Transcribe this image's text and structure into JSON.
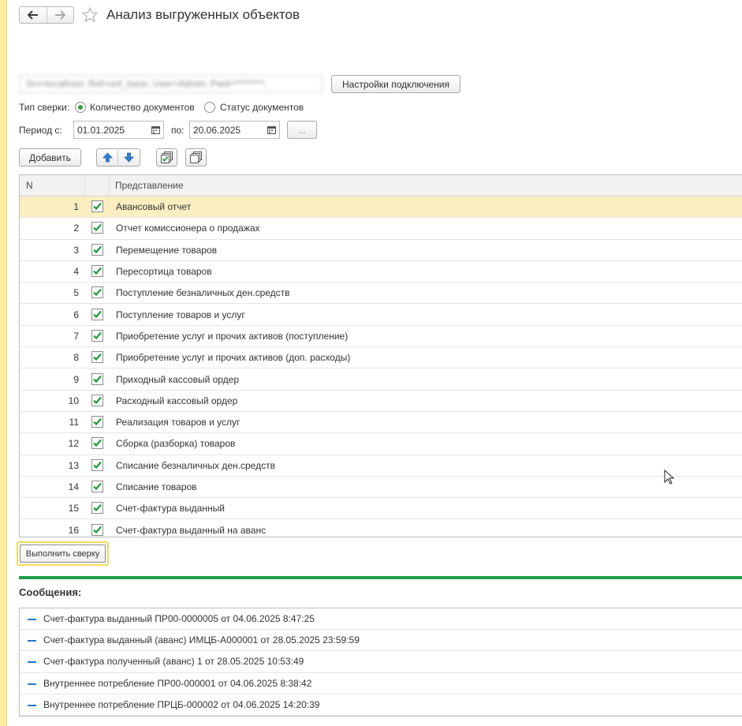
{
  "header": {
    "title": "Анализ выгруженных объектов"
  },
  "connection": {
    "value": "Srv=localhost; Ref=unf_base; User=Admin; Pwd=********;",
    "settings_button": "Настройки подключения"
  },
  "sverka": {
    "label": "Тип сверки:",
    "options": [
      "Количество документов",
      "Статус документов"
    ],
    "selected": "Количество документов"
  },
  "period": {
    "from_label": "Период с:",
    "from_value": "01.01.2025",
    "to_label": "по:",
    "to_value": "20.06.2025",
    "more_button": "..."
  },
  "toolbar": {
    "add_label": "Добавить"
  },
  "table": {
    "columns": [
      "N",
      "Представление"
    ],
    "rows": [
      {
        "n": "1",
        "checked": true,
        "name": "Авансовый отчет"
      },
      {
        "n": "2",
        "checked": true,
        "name": "Отчет комиссионера о продажах"
      },
      {
        "n": "3",
        "checked": true,
        "name": "Перемещение товаров"
      },
      {
        "n": "4",
        "checked": true,
        "name": "Пересортица товаров"
      },
      {
        "n": "5",
        "checked": true,
        "name": "Поступление безналичных ден.средств"
      },
      {
        "n": "6",
        "checked": true,
        "name": "Поступление товаров и услуг"
      },
      {
        "n": "7",
        "checked": true,
        "name": "Приобретение услуг и прочих активов (поступление)"
      },
      {
        "n": "8",
        "checked": true,
        "name": "Приобретение услуг и прочих активов (доп. расходы)"
      },
      {
        "n": "9",
        "checked": true,
        "name": "Приходный кассовый ордер"
      },
      {
        "n": "10",
        "checked": true,
        "name": "Расходный кассовый ордер"
      },
      {
        "n": "11",
        "checked": true,
        "name": "Реализация товаров и услуг"
      },
      {
        "n": "12",
        "checked": true,
        "name": "Сборка (разборка) товаров"
      },
      {
        "n": "13",
        "checked": true,
        "name": "Списание безналичных ден.средств"
      },
      {
        "n": "14",
        "checked": true,
        "name": "Списание товаров"
      },
      {
        "n": "15",
        "checked": true,
        "name": "Счет-фактура выданный"
      },
      {
        "n": "16",
        "checked": true,
        "name": "Счет-фактура выданный на аванс"
      }
    ],
    "selected_row": 0
  },
  "run_button": "Выполнить сверку",
  "messages": {
    "title": "Сообщения:",
    "items": [
      "Счет-фактура выданный ПР00-0000005 от 04.06.2025 8:47:25",
      "Счет-фактура выданный (аванс) ИМЦБ-А000001 от 28.05.2025 23:59:59",
      "Счет-фактура полученный (аванс) 1 от 28.05.2025 10:53:49",
      "Внутреннее потребление ПР00-000001 от 04.06.2025 8:38:42",
      "Внутреннее потребление ПРЦБ-000002 от 04.06.2025 14:20:39"
    ]
  },
  "colors": {
    "accent_green": "#1e9e4a",
    "selected_row": "#fbefc2",
    "left_strip": "#fbeea0",
    "message_dash": "#2a76c6"
  },
  "icons": [
    "back-arrow-icon",
    "forward-arrow-icon",
    "favorite-star-icon",
    "calendar-icon",
    "arrow-up-icon",
    "arrow-down-icon",
    "check-all-icon",
    "uncheck-all-icon",
    "mouse-cursor-icon"
  ]
}
